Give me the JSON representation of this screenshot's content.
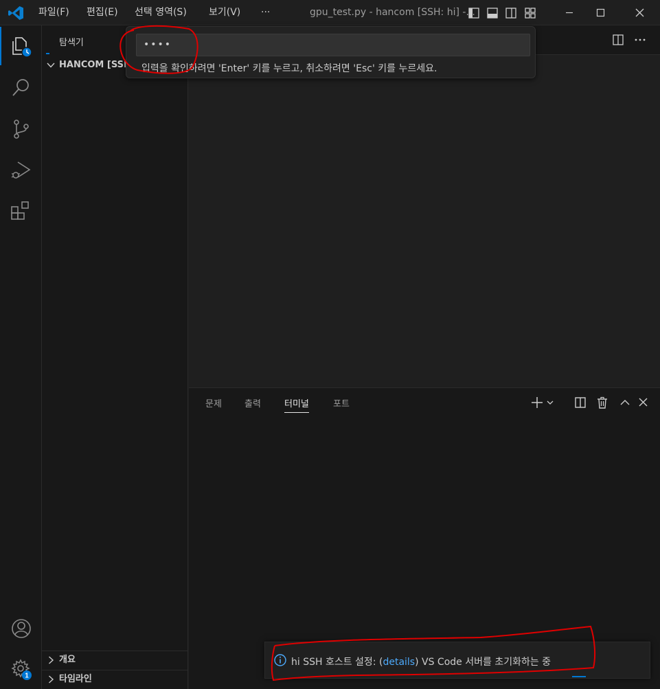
{
  "titlebar": {
    "menu": [
      "파일(F)",
      "편집(E)",
      "선택 영역(S)",
      "보기(V)",
      "···"
    ],
    "title": "gpu_test.py - hancom [SSH: hi] -..."
  },
  "sidebar": {
    "title": "탐색기",
    "folder_label": "HANCOM [SSH",
    "outline_label": "개요",
    "timeline_label": "타임라인"
  },
  "quick_input": {
    "value": "••••",
    "message": "입력을 확인하려면 'Enter' 키를 누르고, 취소하려면 'Esc' 키를 누르세요."
  },
  "panel": {
    "tabs": [
      "문제",
      "출력",
      "터미널",
      "포트"
    ],
    "active_tab": "터미널"
  },
  "notification": {
    "prefix": "hi SSH 호스트 설정: (",
    "link": "details",
    "suffix": ") VS Code 서버를 초기화하는 중"
  },
  "activitybar": {
    "settings_badge": "1"
  },
  "icons": {
    "explorer": "files-icon",
    "search": "search-icon",
    "source_control": "source-control-icon",
    "run_debug": "run-debug-icon",
    "extensions": "extensions-icon",
    "accounts": "account-icon",
    "manage": "gear-icon"
  },
  "colors": {
    "accent": "#0078d4",
    "link": "#4daafc",
    "annotation": "#e00000"
  }
}
